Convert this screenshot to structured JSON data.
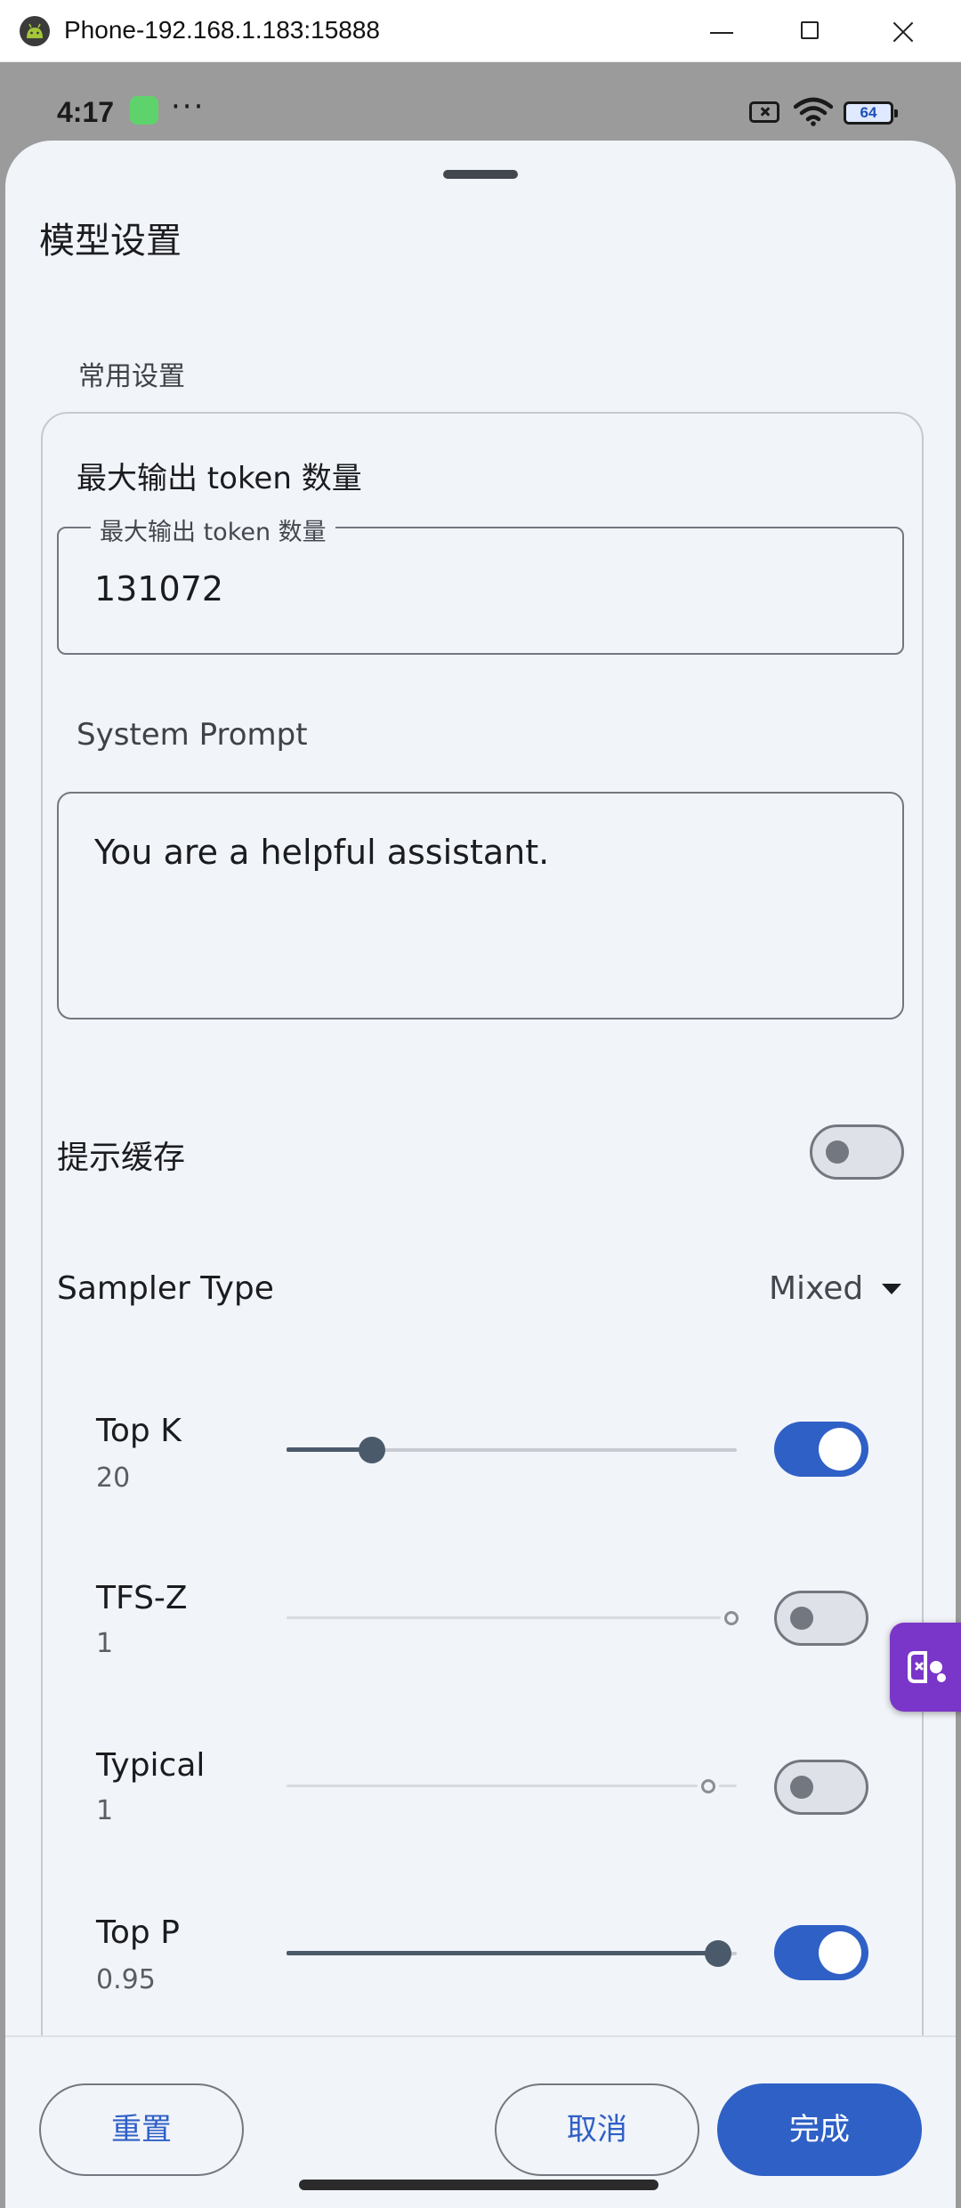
{
  "window": {
    "title": "Phone-192.168.1.183:15888"
  },
  "status_bar": {
    "time": "4:17",
    "dots": "···",
    "battery": "64"
  },
  "sheet": {
    "title": "模型设置",
    "section_common": "常用设置",
    "max_tokens": {
      "heading": "最大输出 token 数量",
      "label": "最大输出 token 数量",
      "value": "131072"
    },
    "system_prompt": {
      "label": "System Prompt",
      "value": "You are a helpful assistant."
    },
    "prompt_cache": {
      "label": "提示缓存",
      "enabled": false
    },
    "sampler_type": {
      "label": "Sampler Type",
      "value": "Mixed"
    },
    "samplers": [
      {
        "name": "Top K",
        "value": "20",
        "enabled": true,
        "level": 0.19
      },
      {
        "name": "TFS-Z",
        "value": "1",
        "enabled": false,
        "level": 1.0
      },
      {
        "name": "Typical",
        "value": "1",
        "enabled": false,
        "level": 0.95
      },
      {
        "name": "Top P",
        "value": "0.95",
        "enabled": true,
        "level": 0.95
      }
    ]
  },
  "actions": {
    "reset": "重置",
    "cancel": "取消",
    "done": "完成"
  },
  "colors": {
    "accent": "#2f60c6",
    "sheet_bg": "#f1f4f9",
    "floating_tab": "#7a35c9"
  }
}
